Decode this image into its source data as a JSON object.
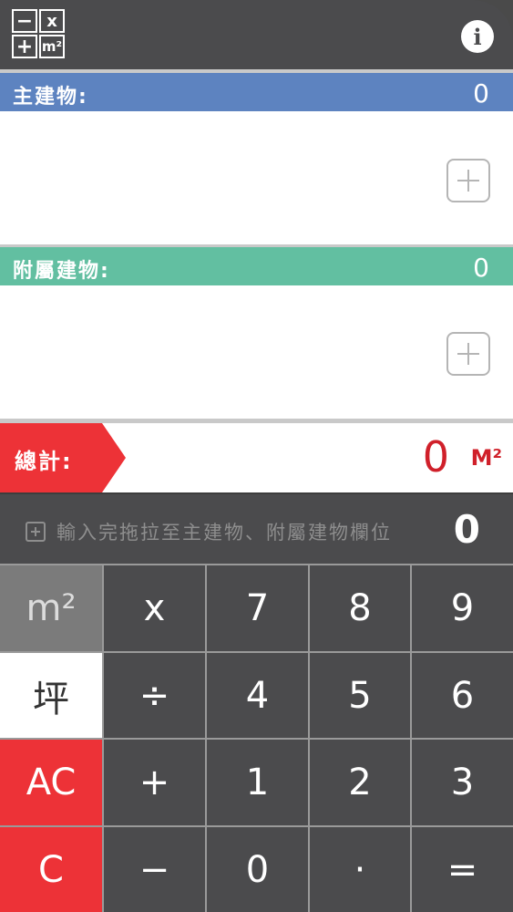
{
  "header": {
    "logo": {
      "minus": "−",
      "times": "x",
      "plus": "+",
      "unit": "m²"
    },
    "info_icon": "i"
  },
  "main_building": {
    "label": "主建物:",
    "value": "0"
  },
  "annex_building": {
    "label": "附屬建物:",
    "value": "0"
  },
  "total": {
    "label": "總計:",
    "value": "0",
    "unit": "M²"
  },
  "display": {
    "hint": "輸入完拖拉至主建物、附屬建物欄位",
    "value": "0"
  },
  "keys": {
    "m2": "m²",
    "ping": "坪",
    "ac": "AC",
    "c": "C",
    "times": "x",
    "divide": "÷",
    "plus": "+",
    "minus": "−",
    "seven": "7",
    "eight": "8",
    "nine": "9",
    "four": "4",
    "five": "5",
    "six": "6",
    "one": "1",
    "two": "2",
    "three": "3",
    "zero": "0",
    "dot": "·",
    "equals": "="
  },
  "colors": {
    "main_header": "#5d83c0",
    "annex_header": "#62bfa1",
    "total_red": "#ed3237",
    "dark_panel": "#4b4b4d"
  }
}
